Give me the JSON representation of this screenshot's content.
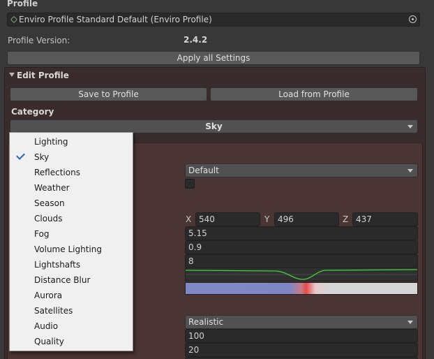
{
  "profile": {
    "label": "Profile",
    "field_value": "Enviro Profile Standard Default (Enviro Profile)",
    "version_label": "Profile Version:",
    "version_value": "2.4.2",
    "apply_button": "Apply all Settings"
  },
  "edit_profile": {
    "title": "Edit Profile",
    "save_button": "Save to Profile",
    "load_button": "Load from Profile",
    "category_label": "Category",
    "category_value": "Sky"
  },
  "sky_settings": {
    "mode_value": "Default",
    "position": {
      "x_label": "X",
      "x": "540",
      "y_label": "Y",
      "y": "496",
      "z_label": "Z",
      "z": "437"
    },
    "field1": "5.15",
    "field2": "0.9",
    "field3": "8",
    "quality_mode": "Realistic",
    "field4": "100",
    "field5": "20"
  },
  "category_dropdown": {
    "selected": "Sky",
    "items": [
      "Lighting",
      "Sky",
      "Reflections",
      "Weather",
      "Season",
      "Clouds",
      "Fog",
      "Volume Lighting",
      "Lightshafts",
      "Distance Blur",
      "Aurora",
      "Satellites",
      "Audio",
      "Quality"
    ]
  },
  "colors": {
    "curve_color": "#3fd13f",
    "check_color": "#2a62c0",
    "gradient_start": "#8089c8",
    "gradient_mid": "#e84848",
    "gradient_end": "#d6d6d6"
  }
}
